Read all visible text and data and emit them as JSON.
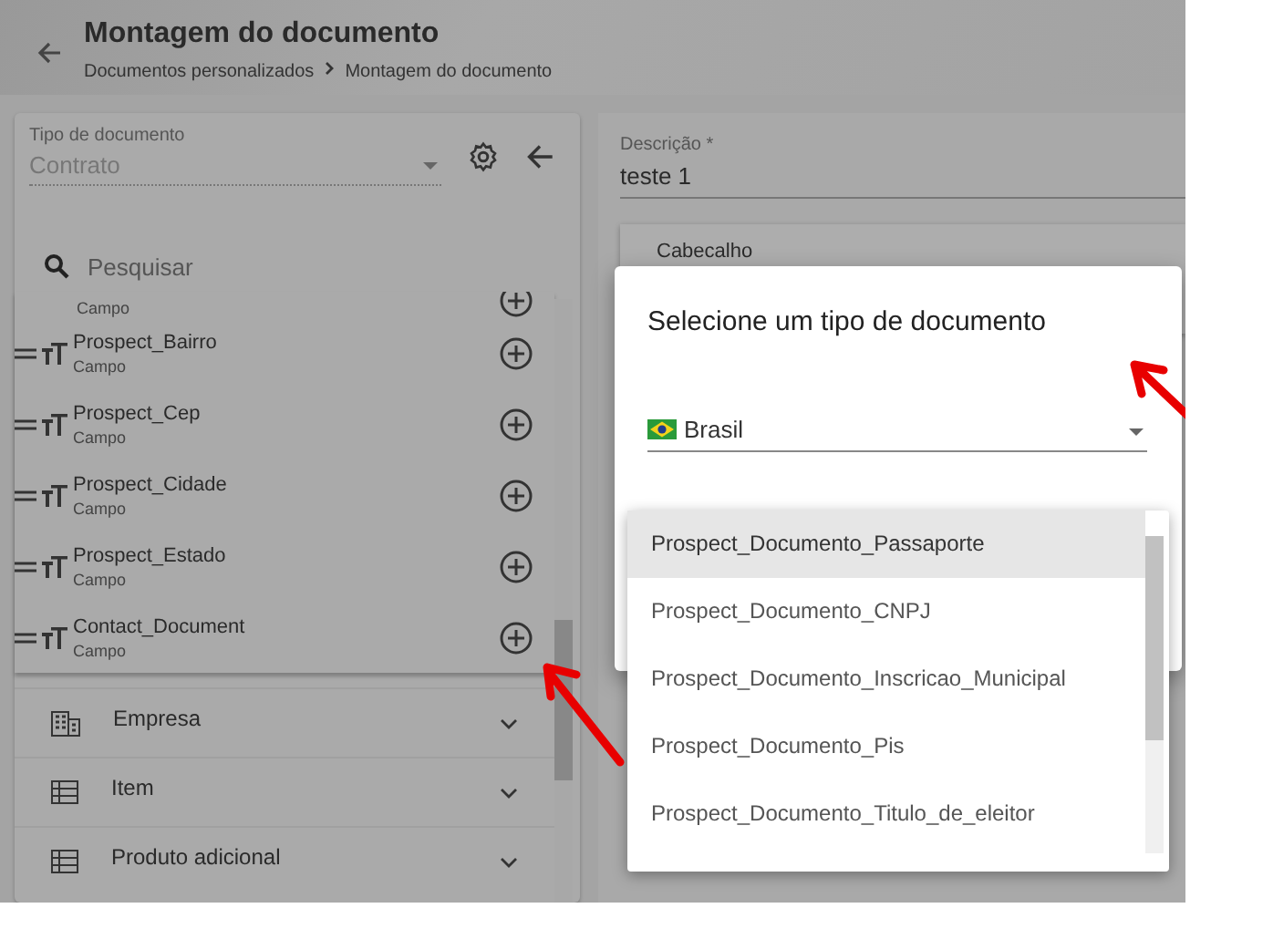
{
  "header": {
    "title": "Montagem do documento",
    "breadcrumb": [
      "Documentos personalizados",
      "Montagem do documento"
    ]
  },
  "left_panel": {
    "document_type": {
      "label": "Tipo de documento",
      "value": "Contrato"
    },
    "search": {
      "placeholder": "Pesquisar"
    },
    "fields": [
      {
        "type": "Campo"
      },
      {
        "name": "Prospect_Bairro",
        "type": "Campo"
      },
      {
        "name": "Prospect_Cep",
        "type": "Campo"
      },
      {
        "name": "Prospect_Cidade",
        "type": "Campo"
      },
      {
        "name": "Prospect_Estado",
        "type": "Campo"
      },
      {
        "name": "Contact_Document",
        "type": "Campo"
      }
    ],
    "sections": [
      {
        "label": "Empresa",
        "kind": "building",
        "expanded": false
      },
      {
        "label": "Item",
        "kind": "list",
        "expanded": false
      },
      {
        "label": "Produto adicional",
        "kind": "list",
        "expanded": false
      }
    ]
  },
  "right_panel": {
    "description": {
      "label": "Descrição *",
      "value": "teste 1"
    },
    "card_title": "Cabecalho"
  },
  "dialog": {
    "title": "Selecione um tipo de documento",
    "country": "Brasil",
    "options": [
      {
        "label": "Prospect_Documento_Passaporte",
        "highlighted": true
      },
      {
        "label": "Prospect_Documento_CNPJ",
        "highlighted": false
      },
      {
        "label": "Prospect_Documento_Inscricao_Municipal",
        "highlighted": false
      },
      {
        "label": "Prospect_Documento_Pis",
        "highlighted": false
      },
      {
        "label": "Prospect_Documento_Titulo_de_eleitor",
        "highlighted": false
      }
    ]
  }
}
